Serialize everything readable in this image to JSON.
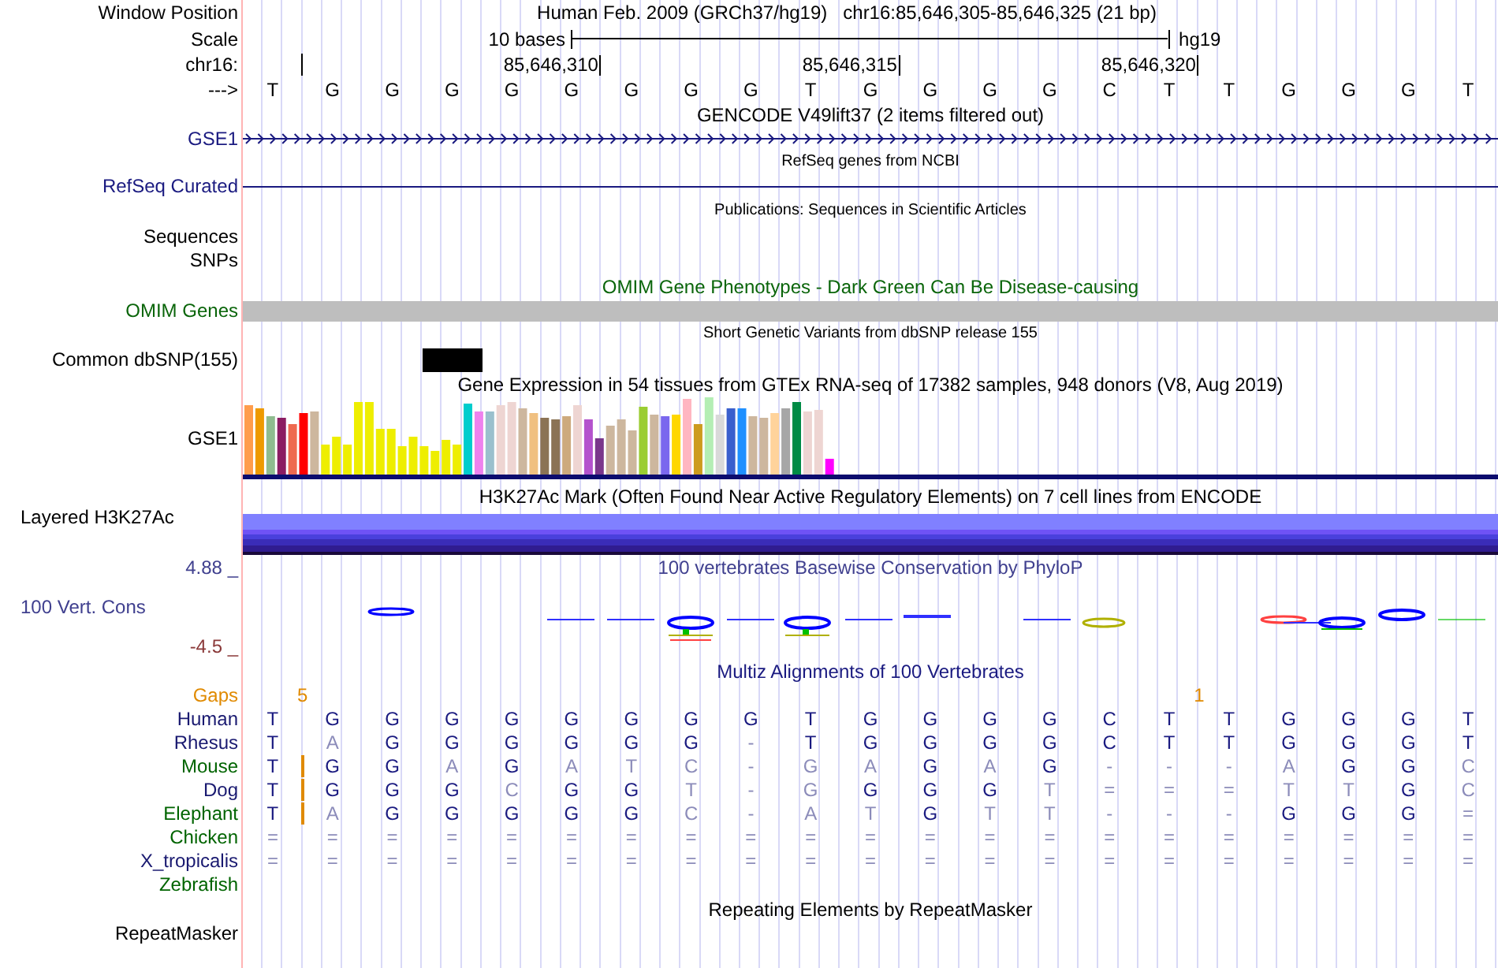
{
  "header": {
    "label": "Window Position",
    "assembly_title": "Human Feb. 2009 (GRCh37/hg19)",
    "position": "chr16:85,646,305-85,646,325 (21 bp)"
  },
  "scale": {
    "label": "Scale",
    "span": "10 bases",
    "assembly": "hg19"
  },
  "coordinates": {
    "label": "chr16:",
    "ticks": [
      "85,646,310",
      "85,646,315",
      "85,646,320"
    ]
  },
  "sequence": {
    "label": "--->",
    "bases": [
      "T",
      "G",
      "G",
      "G",
      "G",
      "G",
      "G",
      "G",
      "G",
      "T",
      "G",
      "G",
      "G",
      "G",
      "C",
      "T",
      "T",
      "G",
      "G",
      "G",
      "T"
    ]
  },
  "gencode": {
    "title": "GENCODE V49lift37 (2 items filtered out)",
    "label": "GSE1"
  },
  "refseq": {
    "title": "RefSeq genes from NCBI",
    "label": "RefSeq Curated"
  },
  "publications": {
    "title": "Publications: Sequences in Scientific Articles",
    "labels": [
      "Sequences",
      "SNPs"
    ]
  },
  "omim": {
    "title": "OMIM Gene Phenotypes - Dark Green Can Be Disease-causing",
    "label": "OMIM Genes"
  },
  "dbsnp": {
    "title": "Short Genetic Variants from dbSNP release 155",
    "label": "Common dbSNP(155)"
  },
  "gtex": {
    "title": "Gene Expression in 54 tissues from GTEx RNA-seq of 17382 samples, 948 donors (V8, Aug 2019)",
    "label": "GSE1"
  },
  "h3k27ac": {
    "title": "H3K27Ac Mark (Often Found Near Active Regulatory Elements) on 7 cell lines from ENCODE",
    "label": "Layered H3K27Ac"
  },
  "conservation": {
    "title": "100 vertebrates Basewise Conservation by PhyloP",
    "label": "100 Vert. Cons",
    "max": "4.88 _",
    "min": "-4.5 _"
  },
  "multiz": {
    "title": "Multiz Alignments of 100 Vertebrates",
    "gaps_label": "Gaps",
    "gap_counts": [
      "5",
      "1"
    ],
    "species": [
      {
        "name": "Human",
        "color": "#191970",
        "insertion": false,
        "bases": [
          {
            "base": "T",
            "match": true
          },
          {
            "base": "G",
            "match": true
          },
          {
            "base": "G",
            "match": true
          },
          {
            "base": "G",
            "match": true
          },
          {
            "base": "G",
            "match": true
          },
          {
            "base": "G",
            "match": true
          },
          {
            "base": "G",
            "match": true
          },
          {
            "base": "G",
            "match": true
          },
          {
            "base": "G",
            "match": true
          },
          {
            "base": "T",
            "match": true
          },
          {
            "base": "G",
            "match": true
          },
          {
            "base": "G",
            "match": true
          },
          {
            "base": "G",
            "match": true
          },
          {
            "base": "G",
            "match": true
          },
          {
            "base": "C",
            "match": true
          },
          {
            "base": "T",
            "match": true
          },
          {
            "base": "T",
            "match": true
          },
          {
            "base": "G",
            "match": true
          },
          {
            "base": "G",
            "match": true
          },
          {
            "base": "G",
            "match": true
          },
          {
            "base": "T",
            "match": true
          }
        ]
      },
      {
        "name": "Rhesus",
        "color": "#191970",
        "insertion": false,
        "bases": [
          {
            "base": "T",
            "match": true
          },
          {
            "base": "A",
            "match": false
          },
          {
            "base": "G",
            "match": true
          },
          {
            "base": "G",
            "match": true
          },
          {
            "base": "G",
            "match": true
          },
          {
            "base": "G",
            "match": true
          },
          {
            "base": "G",
            "match": true
          },
          {
            "base": "G",
            "match": true
          },
          {
            "base": "-",
            "match": false
          },
          {
            "base": "T",
            "match": true
          },
          {
            "base": "G",
            "match": true
          },
          {
            "base": "G",
            "match": true
          },
          {
            "base": "G",
            "match": true
          },
          {
            "base": "G",
            "match": true
          },
          {
            "base": "C",
            "match": true
          },
          {
            "base": "T",
            "match": true
          },
          {
            "base": "T",
            "match": true
          },
          {
            "base": "G",
            "match": true
          },
          {
            "base": "G",
            "match": true
          },
          {
            "base": "G",
            "match": true
          },
          {
            "base": "T",
            "match": true
          }
        ]
      },
      {
        "name": "Mouse",
        "color": "#006400",
        "insertion": true,
        "bases": [
          {
            "base": "T",
            "match": true
          },
          {
            "base": "G",
            "match": true
          },
          {
            "base": "G",
            "match": true
          },
          {
            "base": "A",
            "match": false
          },
          {
            "base": "G",
            "match": true
          },
          {
            "base": "A",
            "match": false
          },
          {
            "base": "T",
            "match": false
          },
          {
            "base": "C",
            "match": false
          },
          {
            "base": "-",
            "match": false
          },
          {
            "base": "G",
            "match": false
          },
          {
            "base": "A",
            "match": false
          },
          {
            "base": "G",
            "match": true
          },
          {
            "base": "A",
            "match": false
          },
          {
            "base": "G",
            "match": true
          },
          {
            "base": "-",
            "match": false
          },
          {
            "base": "-",
            "match": false
          },
          {
            "base": "-",
            "match": false
          },
          {
            "base": "A",
            "match": false
          },
          {
            "base": "G",
            "match": true
          },
          {
            "base": "G",
            "match": true
          },
          {
            "base": "C",
            "match": false
          }
        ]
      },
      {
        "name": "Dog",
        "color": "#191970",
        "insertion": true,
        "bases": [
          {
            "base": "T",
            "match": true
          },
          {
            "base": "G",
            "match": true
          },
          {
            "base": "G",
            "match": true
          },
          {
            "base": "G",
            "match": true
          },
          {
            "base": "C",
            "match": false
          },
          {
            "base": "G",
            "match": true
          },
          {
            "base": "G",
            "match": true
          },
          {
            "base": "T",
            "match": false
          },
          {
            "base": "-",
            "match": false
          },
          {
            "base": "G",
            "match": false
          },
          {
            "base": "G",
            "match": true
          },
          {
            "base": "G",
            "match": true
          },
          {
            "base": "G",
            "match": true
          },
          {
            "base": "T",
            "match": false
          },
          {
            "base": "=",
            "match": false
          },
          {
            "base": "=",
            "match": false
          },
          {
            "base": "=",
            "match": false
          },
          {
            "base": "T",
            "match": false
          },
          {
            "base": "T",
            "match": false
          },
          {
            "base": "G",
            "match": true
          },
          {
            "base": "C",
            "match": false
          }
        ]
      },
      {
        "name": "Elephant",
        "color": "#006400",
        "insertion": true,
        "bases": [
          {
            "base": "T",
            "match": true
          },
          {
            "base": "A",
            "match": false
          },
          {
            "base": "G",
            "match": true
          },
          {
            "base": "G",
            "match": true
          },
          {
            "base": "G",
            "match": true
          },
          {
            "base": "G",
            "match": true
          },
          {
            "base": "G",
            "match": true
          },
          {
            "base": "C",
            "match": false
          },
          {
            "base": "-",
            "match": false
          },
          {
            "base": "A",
            "match": false
          },
          {
            "base": "T",
            "match": false
          },
          {
            "base": "G",
            "match": true
          },
          {
            "base": "T",
            "match": false
          },
          {
            "base": "T",
            "match": false
          },
          {
            "base": "-",
            "match": false
          },
          {
            "base": "-",
            "match": false
          },
          {
            "base": "-",
            "match": false
          },
          {
            "base": "G",
            "match": true
          },
          {
            "base": "G",
            "match": true
          },
          {
            "base": "G",
            "match": true
          },
          {
            "base": "=",
            "match": false
          }
        ]
      },
      {
        "name": "Chicken",
        "color": "#006400",
        "insertion": false,
        "bases": [
          {
            "base": "=",
            "match": false
          },
          {
            "base": "=",
            "match": false
          },
          {
            "base": "=",
            "match": false
          },
          {
            "base": "=",
            "match": false
          },
          {
            "base": "=",
            "match": false
          },
          {
            "base": "=",
            "match": false
          },
          {
            "base": "=",
            "match": false
          },
          {
            "base": "=",
            "match": false
          },
          {
            "base": "=",
            "match": false
          },
          {
            "base": "=",
            "match": false
          },
          {
            "base": "=",
            "match": false
          },
          {
            "base": "=",
            "match": false
          },
          {
            "base": "=",
            "match": false
          },
          {
            "base": "=",
            "match": false
          },
          {
            "base": "=",
            "match": false
          },
          {
            "base": "=",
            "match": false
          },
          {
            "base": "=",
            "match": false
          },
          {
            "base": "=",
            "match": false
          },
          {
            "base": "=",
            "match": false
          },
          {
            "base": "=",
            "match": false
          },
          {
            "base": "=",
            "match": false
          }
        ]
      },
      {
        "name": "X_tropicalis",
        "color": "#191970",
        "insertion": false,
        "bases": [
          {
            "base": "=",
            "match": false
          },
          {
            "base": "=",
            "match": false
          },
          {
            "base": "=",
            "match": false
          },
          {
            "base": "=",
            "match": false
          },
          {
            "base": "=",
            "match": false
          },
          {
            "base": "=",
            "match": false
          },
          {
            "base": "=",
            "match": false
          },
          {
            "base": "=",
            "match": false
          },
          {
            "base": "=",
            "match": false
          },
          {
            "base": "=",
            "match": false
          },
          {
            "base": "=",
            "match": false
          },
          {
            "base": "=",
            "match": false
          },
          {
            "base": "=",
            "match": false
          },
          {
            "base": "=",
            "match": false
          },
          {
            "base": "=",
            "match": false
          },
          {
            "base": "=",
            "match": false
          },
          {
            "base": "=",
            "match": false
          },
          {
            "base": "=",
            "match": false
          },
          {
            "base": "=",
            "match": false
          },
          {
            "base": "=",
            "match": false
          },
          {
            "base": "=",
            "match": false
          }
        ]
      },
      {
        "name": "Zebrafish",
        "color": "#006400",
        "insertion": false
      }
    ]
  },
  "repeatmasker": {
    "title": "Repeating Elements by RepeatMasker",
    "label": "RepeatMasker"
  }
}
